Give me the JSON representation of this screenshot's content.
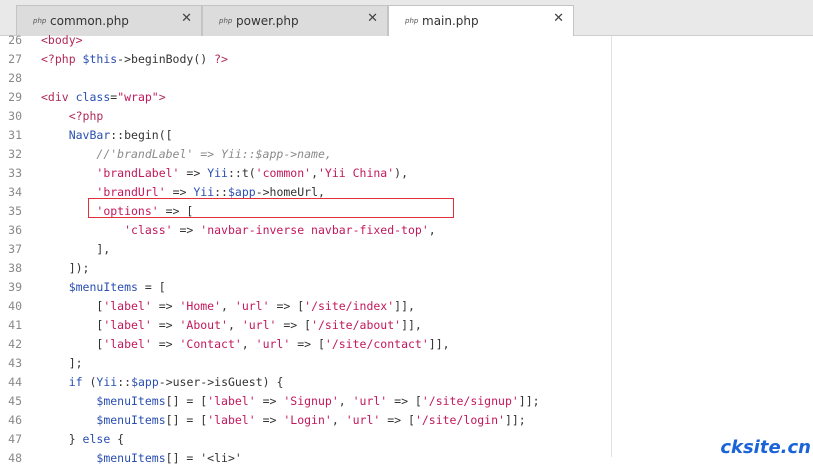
{
  "tabs": [
    {
      "icon": "php",
      "label": "common.php",
      "close": "✕",
      "active": false
    },
    {
      "icon": "php",
      "label": "power.php",
      "close": "✕",
      "active": false
    },
    {
      "icon": "php",
      "label": "main.php",
      "close": "✕",
      "active": true
    }
  ],
  "editor": {
    "line_numbers": [
      "26",
      "27",
      "28",
      "29",
      "30",
      "31",
      "32",
      "33",
      "34",
      "35",
      "36",
      "37",
      "38",
      "39",
      "40",
      "41",
      "42",
      "43",
      "44",
      "45",
      "46",
      "47",
      "48"
    ],
    "lines": [
      [
        [
          "t-tag",
          "<body>"
        ]
      ],
      [
        [
          "t-tag",
          "<?php "
        ],
        [
          "t-var",
          "$this"
        ],
        [
          "t-op",
          "->beginBody() "
        ],
        [
          "t-tag",
          "?>"
        ]
      ],
      [],
      [
        [
          "t-tag",
          "<div "
        ],
        [
          "t-kw",
          "class"
        ],
        [
          "t-op",
          "="
        ],
        [
          "t-str",
          "\"wrap\""
        ],
        [
          "t-tag",
          ">"
        ]
      ],
      [
        [
          "t-op",
          "    "
        ],
        [
          "t-tag",
          "<?php"
        ]
      ],
      [
        [
          "t-op",
          "    "
        ],
        [
          "t-cls",
          "NavBar"
        ],
        [
          "t-op",
          "::begin(["
        ]
      ],
      [
        [
          "t-op",
          "        "
        ],
        [
          "t-cmt",
          "//'brandLabel' => Yii::$app->name,"
        ]
      ],
      [
        [
          "t-op",
          "        "
        ],
        [
          "t-str",
          "'brandLabel'"
        ],
        [
          "t-op",
          " => "
        ],
        [
          "t-cls",
          "Yii"
        ],
        [
          "t-op",
          "::t("
        ],
        [
          "t-str",
          "'common'"
        ],
        [
          "t-op",
          ","
        ],
        [
          "t-str",
          "'Yii China'"
        ],
        [
          "t-op",
          "),"
        ]
      ],
      [
        [
          "t-op",
          "        "
        ],
        [
          "t-str",
          "'brandUrl'"
        ],
        [
          "t-op",
          " => "
        ],
        [
          "t-cls",
          "Yii"
        ],
        [
          "t-op",
          "::"
        ],
        [
          "t-var",
          "$app"
        ],
        [
          "t-op",
          "->homeUrl,"
        ]
      ],
      [
        [
          "t-op",
          "        "
        ],
        [
          "t-str",
          "'options'"
        ],
        [
          "t-op",
          " => ["
        ]
      ],
      [
        [
          "t-op",
          "            "
        ],
        [
          "t-str",
          "'class'"
        ],
        [
          "t-op",
          " => "
        ],
        [
          "t-str",
          "'navbar-inverse navbar-fixed-top'"
        ],
        [
          "t-op",
          ","
        ]
      ],
      [
        [
          "t-op",
          "        ],"
        ]
      ],
      [
        [
          "t-op",
          "    ]);"
        ]
      ],
      [
        [
          "t-op",
          "    "
        ],
        [
          "t-var",
          "$menuItems"
        ],
        [
          "t-op",
          " = ["
        ]
      ],
      [
        [
          "t-op",
          "        ["
        ],
        [
          "t-str",
          "'label'"
        ],
        [
          "t-op",
          " => "
        ],
        [
          "t-str",
          "'Home'"
        ],
        [
          "t-op",
          ", "
        ],
        [
          "t-str",
          "'url'"
        ],
        [
          "t-op",
          " => ["
        ],
        [
          "t-str",
          "'/site/index'"
        ],
        [
          "t-op",
          "]],"
        ]
      ],
      [
        [
          "t-op",
          "        ["
        ],
        [
          "t-str",
          "'label'"
        ],
        [
          "t-op",
          " => "
        ],
        [
          "t-str",
          "'About'"
        ],
        [
          "t-op",
          ", "
        ],
        [
          "t-str",
          "'url'"
        ],
        [
          "t-op",
          " => ["
        ],
        [
          "t-str",
          "'/site/about'"
        ],
        [
          "t-op",
          "]],"
        ]
      ],
      [
        [
          "t-op",
          "        ["
        ],
        [
          "t-str",
          "'label'"
        ],
        [
          "t-op",
          " => "
        ],
        [
          "t-str",
          "'Contact'"
        ],
        [
          "t-op",
          ", "
        ],
        [
          "t-str",
          "'url'"
        ],
        [
          "t-op",
          " => ["
        ],
        [
          "t-str",
          "'/site/contact'"
        ],
        [
          "t-op",
          "]],"
        ]
      ],
      [
        [
          "t-op",
          "    ];"
        ]
      ],
      [
        [
          "t-op",
          "    "
        ],
        [
          "t-kw",
          "if"
        ],
        [
          "t-op",
          " ("
        ],
        [
          "t-cls",
          "Yii"
        ],
        [
          "t-op",
          "::"
        ],
        [
          "t-var",
          "$app"
        ],
        [
          "t-op",
          "->user->isGuest) {"
        ]
      ],
      [
        [
          "t-op",
          "        "
        ],
        [
          "t-var",
          "$menuItems"
        ],
        [
          "t-op",
          "[] = ["
        ],
        [
          "t-str",
          "'label'"
        ],
        [
          "t-op",
          " => "
        ],
        [
          "t-str",
          "'Signup'"
        ],
        [
          "t-op",
          ", "
        ],
        [
          "t-str",
          "'url'"
        ],
        [
          "t-op",
          " => ["
        ],
        [
          "t-str",
          "'/site/signup'"
        ],
        [
          "t-op",
          "]];"
        ]
      ],
      [
        [
          "t-op",
          "        "
        ],
        [
          "t-var",
          "$menuItems"
        ],
        [
          "t-op",
          "[] = ["
        ],
        [
          "t-str",
          "'label'"
        ],
        [
          "t-op",
          " => "
        ],
        [
          "t-str",
          "'Login'"
        ],
        [
          "t-op",
          ", "
        ],
        [
          "t-str",
          "'url'"
        ],
        [
          "t-op",
          " => ["
        ],
        [
          "t-str",
          "'/site/login'"
        ],
        [
          "t-op",
          "]];"
        ]
      ],
      [
        [
          "t-op",
          "    } "
        ],
        [
          "t-kw",
          "else"
        ],
        [
          "t-op",
          " {"
        ]
      ],
      [
        [
          "t-op",
          "        "
        ],
        [
          "t-var",
          "$menuItems"
        ],
        [
          "t-op",
          "[] = '<li>'"
        ]
      ]
    ]
  },
  "watermark": "cksite.cn",
  "colors": {
    "highlight_box": "#e0303a",
    "tab_active": "#ffffff",
    "tab_inactive": "#dcdcdc"
  }
}
